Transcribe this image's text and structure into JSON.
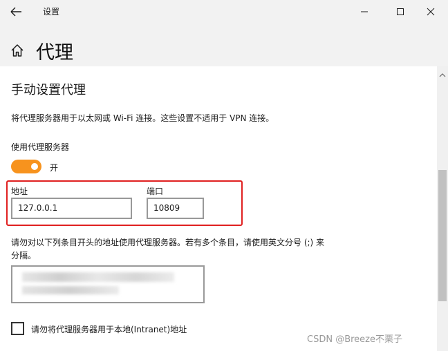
{
  "window": {
    "title": "设置"
  },
  "page": {
    "title": "代理"
  },
  "section": {
    "title": "手动设置代理",
    "description": "将代理服务器用于以太网或 Wi-Fi 连接。这些设置不适用于 VPN 连接。"
  },
  "use_proxy": {
    "label": "使用代理服务器",
    "state_label": "开",
    "on": true,
    "accent_color": "#f7931e"
  },
  "address": {
    "label": "地址",
    "value": "127.0.0.1"
  },
  "port": {
    "label": "端口",
    "value": "10809"
  },
  "highlight_color": "#e02020",
  "exclusions": {
    "description": "请勿对以下列条目开头的地址使用代理服务器。若有多个条目，请使用英文分号 (;) 来分隔。"
  },
  "bypass_local": {
    "label": "请勿将代理服务器用于本地(Intranet)地址",
    "checked": false
  },
  "watermark": "CSDN @Breeze不栗子"
}
